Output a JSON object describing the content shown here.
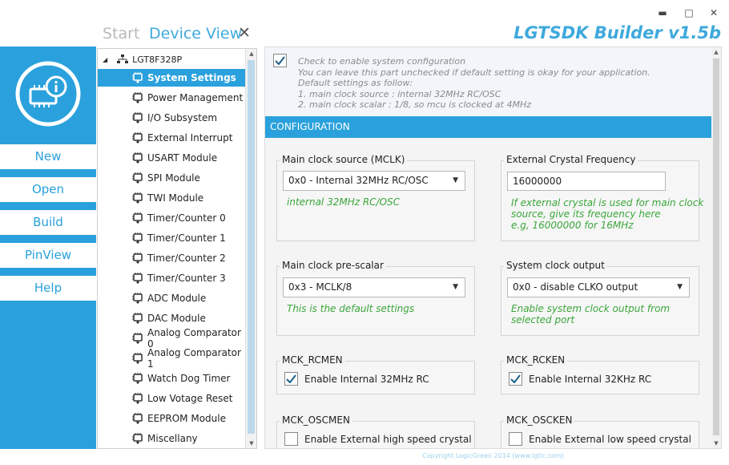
{
  "window": {
    "title": "LGTSDK Builder v1.5b",
    "minimize_glyph": "▬",
    "maximize_glyph": "□",
    "close_glyph": "✕"
  },
  "tabs": {
    "start": "Start",
    "device_view": "Device View",
    "close_glyph": "✕"
  },
  "nav": {
    "logo_icon": "chip-info-icon",
    "items": [
      "New",
      "Open",
      "Build",
      "PinView",
      "Help"
    ]
  },
  "tree": {
    "root": "LGT8F328P",
    "root_icon": "network-icon",
    "item_icon": "module-icon",
    "selected_index": 0,
    "items": [
      "System Settings",
      "Power Management",
      "I/O Subsystem",
      "External Interrupt",
      "USART Module",
      "SPI Module",
      "TWI Module",
      "Timer/Counter 0",
      "Timer/Counter 1",
      "Timer/Counter 2",
      "Timer/Counter 3",
      "ADC Module",
      "DAC Module",
      "Analog Comparator 0",
      "Analog Comparator 1",
      "Watch Dog Timer",
      "Low Votage Reset",
      "EEPROM Module",
      "Miscellany"
    ]
  },
  "info": {
    "enable_checked": true,
    "lines": [
      "Check to enable system configuration",
      "You can leave this part unchecked if default setting is okay for your application.",
      "Default settings as follow:",
      "1. main clock source : internal 32MHz RC/OSC",
      "2. main clock scalar : 1/8, so mcu is clocked at 4MHz"
    ]
  },
  "config": {
    "header": "CONFIGURATION",
    "mclk": {
      "title": "Main clock source (MCLK)",
      "value": "0x0 - Internal 32MHz RC/OSC",
      "hint": "internal 32MHz RC/OSC"
    },
    "crystal": {
      "title": "External Crystal Frequency",
      "value": "16000000",
      "hint_lines": [
        "If external crystal is used for main clock",
        "source, give its frequency here",
        "e.g, 16000000 for 16MHz"
      ]
    },
    "prescalar": {
      "title": "Main clock pre-scalar",
      "value": "0x3 - MCLK/8",
      "hint": "This is the default settings"
    },
    "clkout": {
      "title": "System clock output",
      "value": "0x0 - disable CLKO output",
      "hint_lines": [
        "Enable system clock output from",
        "selected port"
      ]
    },
    "rcmen": {
      "title": "MCK_RCMEN",
      "label": "Enable Internal 32MHz RC",
      "checked": true
    },
    "rcken": {
      "title": "MCK_RCKEN",
      "label": "Enable Internal 32KHz RC",
      "checked": true
    },
    "oscmen": {
      "title": "MCK_OSCMEN",
      "label": "Enable External high speed crystal",
      "checked": false
    },
    "oscken": {
      "title": "MCK_OSCKEN",
      "label": "Enable External low speed crystal",
      "checked": false
    }
  },
  "footer": "Copyright LogicGreen 2014 (www.lgtic.com)",
  "colors": {
    "accent": "#2aa1dc",
    "hint_green": "#3aa63a"
  }
}
